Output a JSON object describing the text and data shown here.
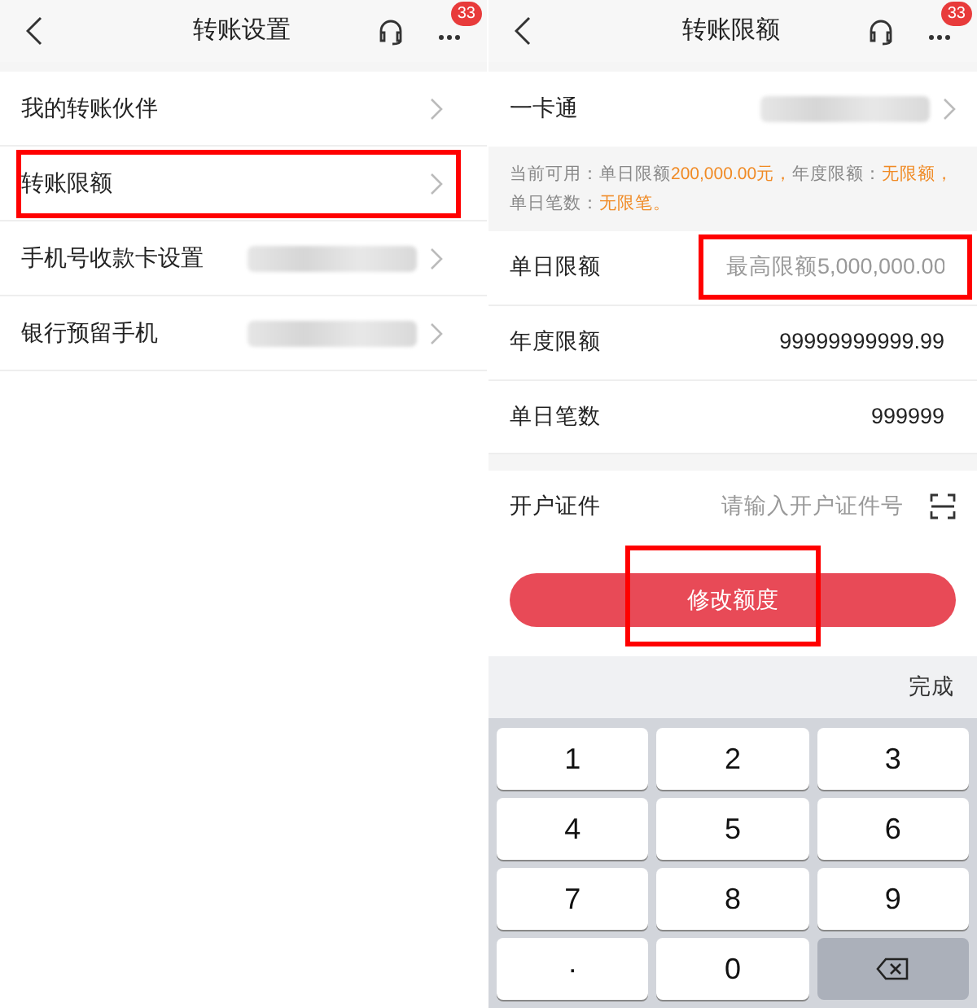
{
  "left": {
    "header": {
      "title": "转账设置",
      "badge": "33"
    },
    "rows": [
      {
        "label": "我的转账伙伴",
        "masked": false,
        "highlighted": false
      },
      {
        "label": "转账限额",
        "masked": false,
        "highlighted": true
      },
      {
        "label": "手机号收款卡设置",
        "masked": true,
        "highlighted": false
      },
      {
        "label": "银行预留手机",
        "masked": true,
        "highlighted": false
      }
    ]
  },
  "right": {
    "header": {
      "title": "转账限额",
      "badge": "33"
    },
    "card_row": {
      "label": "一卡通",
      "masked": true
    },
    "note": [
      {
        "text": "当前可用：单日限额",
        "emphasis": false
      },
      {
        "text": "200,000.00元，",
        "emphasis": true
      },
      {
        "text": "年度限额：",
        "emphasis": false
      },
      {
        "text": "无限额，",
        "emphasis": true
      },
      {
        "text": "单日笔数：",
        "emphasis": false
      },
      {
        "text": "无限笔。",
        "emphasis": true
      }
    ],
    "fields": [
      {
        "label": "单日限额",
        "placeholder": "最高限额5,000,000.00",
        "highlighted": true
      },
      {
        "label": "年度限额",
        "value": "99999999999.99",
        "highlighted": false
      },
      {
        "label": "单日笔数",
        "value": "999999",
        "highlighted": false
      }
    ],
    "id_field": {
      "label": "开户证件",
      "placeholder": "请输入开户证件号"
    },
    "submit": {
      "label": "修改额度",
      "highlighted": true
    },
    "keyboard": {
      "done": "完成",
      "keys": [
        {
          "kind": "digit",
          "label": "1"
        },
        {
          "kind": "digit",
          "label": "2"
        },
        {
          "kind": "digit",
          "label": "3"
        },
        {
          "kind": "digit",
          "label": "4"
        },
        {
          "kind": "digit",
          "label": "5"
        },
        {
          "kind": "digit",
          "label": "6"
        },
        {
          "kind": "digit",
          "label": "7"
        },
        {
          "kind": "digit",
          "label": "8"
        },
        {
          "kind": "digit",
          "label": "9"
        },
        {
          "kind": "digit",
          "label": "·"
        },
        {
          "kind": "digit",
          "label": "0"
        },
        {
          "kind": "delete"
        }
      ]
    }
  }
}
